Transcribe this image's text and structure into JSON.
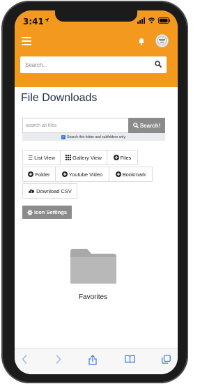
{
  "status_bar": {
    "time": "3:41",
    "icons": [
      "location-arrow-icon",
      "signal-icon",
      "wifi-icon",
      "battery-icon"
    ]
  },
  "header": {
    "icons": [
      "hamburger-menu-icon",
      "bell-icon",
      "avatar"
    ],
    "search": {
      "placeholder": "Search...",
      "value": ""
    }
  },
  "page": {
    "title": "File Downloads",
    "file_search": {
      "placeholder": "search all files",
      "button_label": "Search!",
      "subfolder_checked": true,
      "subfolder_label": "Search this folder and subfolders only."
    },
    "toolbar": {
      "list_view": "List View",
      "gallery_view": "Gallery View",
      "files": "Files",
      "folder": "Folder",
      "youtube_video": "Youtube Video",
      "bookmark": "Bookmark",
      "download_csv": "Download CSV"
    },
    "icon_settings": "Icon Settings",
    "folders": [
      {
        "label": "Favorites"
      }
    ]
  },
  "browser_bar": {
    "icons": [
      "back-icon",
      "forward-icon",
      "share-icon",
      "bookmarks-icon",
      "tabs-icon"
    ]
  },
  "colors": {
    "header": "#f39a1e",
    "title": "#1f2d44",
    "search_button": "#8b8b8b",
    "browser_icons": "#3a7bd5"
  }
}
